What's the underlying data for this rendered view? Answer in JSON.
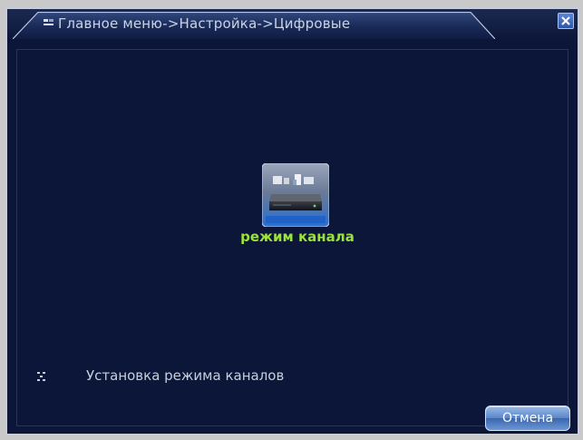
{
  "window": {
    "title": "Главное меню->Настройка->Цифровые"
  },
  "main": {
    "channel_mode": {
      "label": "режим канала",
      "icon": "channel-mode-icon"
    },
    "status": {
      "icon": "drag-handle-icon",
      "text": "Установка режима каналов"
    }
  },
  "footer": {
    "cancel_label": "Отмена"
  },
  "colors": {
    "background": "#0c1638",
    "title_text": "#c9d3e6",
    "label_green": "#9be23a",
    "status_text": "#c6cede",
    "button_blue": "#5a86c8"
  }
}
